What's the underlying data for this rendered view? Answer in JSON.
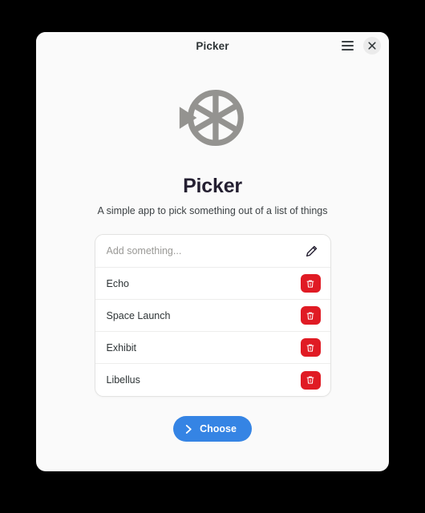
{
  "window": {
    "title": "Picker",
    "menu_icon": "hamburger-menu-icon",
    "close_icon": "close-icon"
  },
  "app": {
    "logo_icon": "picker-wheel-logo-icon",
    "title": "Picker",
    "subtitle": "A simple app to pick something out of a list of things"
  },
  "entry": {
    "value": "",
    "placeholder": "Add something...",
    "edit_icon": "pencil-icon"
  },
  "list": {
    "items": [
      {
        "label": "Echo",
        "delete_icon": "trash-icon"
      },
      {
        "label": "Space Launch",
        "delete_icon": "trash-icon"
      },
      {
        "label": "Exhibit",
        "delete_icon": "trash-icon"
      },
      {
        "label": "Libellus",
        "delete_icon": "trash-icon"
      }
    ]
  },
  "choose": {
    "label": "Choose",
    "icon": "chevron-right-icon"
  },
  "colors": {
    "accent_blue": "#3584e4",
    "destructive_red": "#e01b24",
    "window_bg": "#fafafa",
    "card_bg": "#ffffff",
    "desktop_bg": "#000000",
    "logo_gray": "#949390"
  }
}
